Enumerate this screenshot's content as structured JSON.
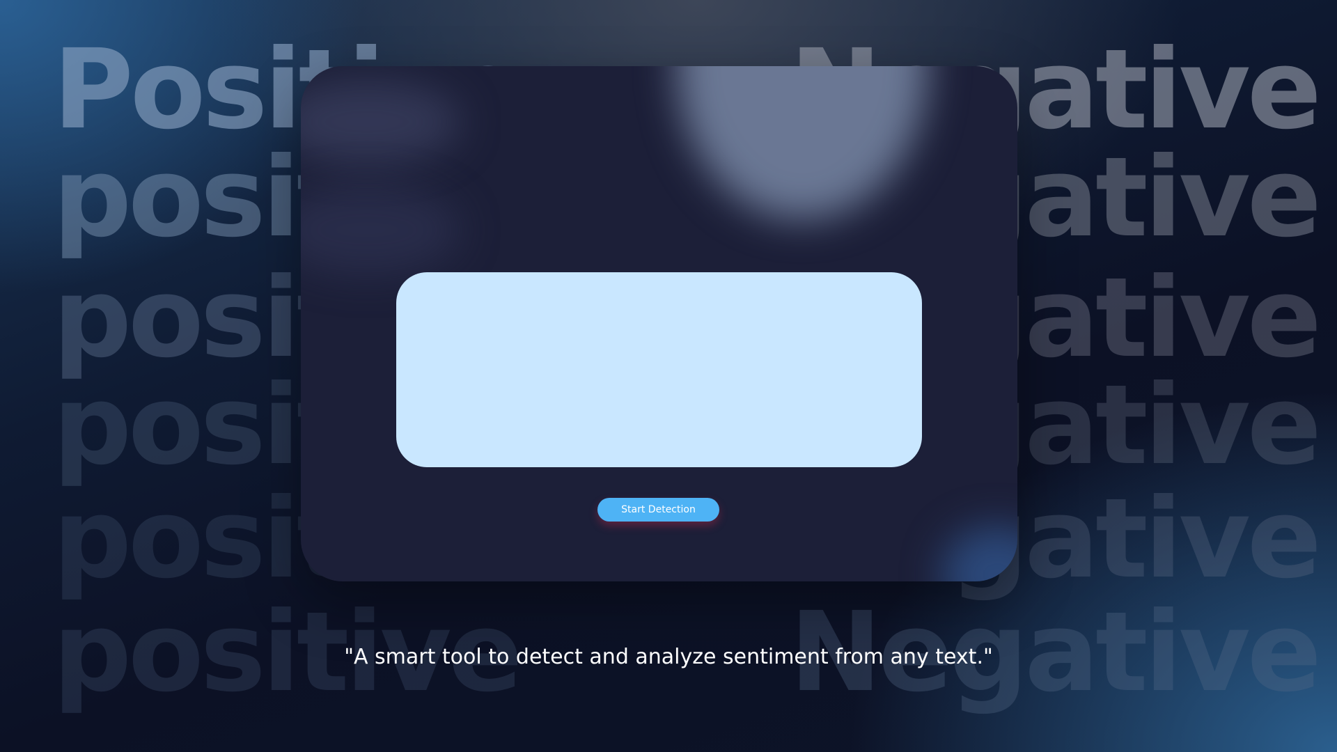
{
  "background": {
    "left_words": [
      "Positive",
      "positive",
      "positive",
      "positive",
      "positive",
      "positive"
    ],
    "right_words": [
      "Negative",
      "Negative",
      "Negative",
      "Negative",
      "Negative",
      "Negative"
    ]
  },
  "card": {
    "textarea": {
      "value": "",
      "placeholder": ""
    },
    "start_button_label": "Start Detection"
  },
  "tagline": "\"A smart tool to detect and analyze sentiment from any text.\"",
  "colors": {
    "card_background": "#1c1f38",
    "textarea_background": "#c9e7ff",
    "button_background": "#4eb3f5",
    "tagline_text": "#ffffff"
  }
}
